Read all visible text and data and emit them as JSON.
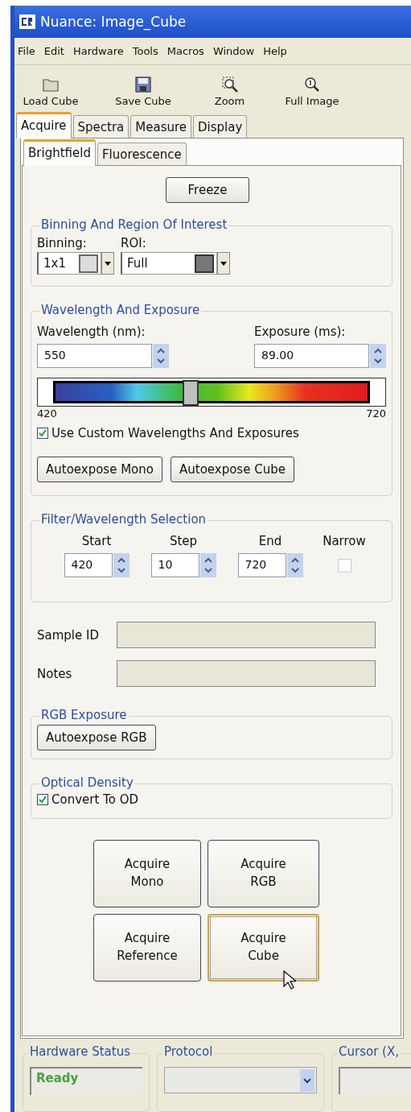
{
  "window": {
    "title": "Nuance: Image_Cube"
  },
  "menu": [
    {
      "label": "File"
    },
    {
      "label": "Edit"
    },
    {
      "label": "Hardware"
    },
    {
      "label": "Tools"
    },
    {
      "label": "Macros"
    },
    {
      "label": "Window"
    },
    {
      "label": "Help"
    }
  ],
  "toolbar": [
    {
      "label": "Load Cube",
      "kind": "folder"
    },
    {
      "label": "Save Cube",
      "kind": "floppy"
    },
    {
      "label": "Zoom",
      "kind": "zoom"
    },
    {
      "label": "Full Image",
      "kind": "fullimage"
    }
  ],
  "tabs": [
    {
      "label": "Acquire",
      "selected": true
    },
    {
      "label": "Spectra",
      "selected": false
    },
    {
      "label": "Measure",
      "selected": false
    },
    {
      "label": "Display",
      "selected": false
    }
  ],
  "subtabs": [
    {
      "label": "Brightfield",
      "selected": true
    },
    {
      "label": "Fluorescence",
      "selected": false
    }
  ],
  "freeze_button": "Freeze",
  "binning_roi": {
    "title": "Binning And Region Of Interest",
    "binning": {
      "label": "Binning:",
      "value": "1x1"
    },
    "roi": {
      "label": "ROI:",
      "value": "Full"
    }
  },
  "wavelength_exposure": {
    "title": "Wavelength And Exposure",
    "wavelength": {
      "label": "Wavelength (nm):",
      "value": "550"
    },
    "exposure": {
      "label": "Exposure (ms):",
      "value": "89.00"
    },
    "slider": {
      "level": 0.433,
      "min_label": "420",
      "max_label": "720"
    },
    "custom": {
      "label": "Use Custom Wavelengths And Exposures",
      "checked": true
    },
    "buttons": [
      "Autoexpose Mono",
      "Autoexpose Cube"
    ]
  },
  "filter_selection": {
    "title": "Filter/Wavelength Selection",
    "columns": [
      {
        "label": "Start",
        "value": "420"
      },
      {
        "label": "Step",
        "value": "10"
      },
      {
        "label": "End",
        "value": "720"
      }
    ],
    "narrow": {
      "label": "Narrow",
      "checked": false
    }
  },
  "fields": [
    {
      "label": "Sample ID"
    },
    {
      "label": "Notes"
    }
  ],
  "rgb_exposure": {
    "title": "RGB Exposure",
    "button": "Autoexpose RGB"
  },
  "optical_density": {
    "title": "Optical Density",
    "checkbox": {
      "label": "Convert To OD",
      "checked": true
    }
  },
  "acquire_buttons": [
    {
      "label": "Acquire\nMono",
      "focused": false
    },
    {
      "label": "Acquire\nRGB",
      "focused": false
    },
    {
      "label": "Acquire\nReference",
      "focused": false
    },
    {
      "label": "Acquire\nCube",
      "focused": true
    }
  ],
  "status_bar": {
    "hardware_status": {
      "title": "Hardware Status",
      "value": "Ready"
    },
    "protocol": {
      "title": "Protocol"
    },
    "cursor": {
      "title": "Cursor (X,"
    }
  }
}
